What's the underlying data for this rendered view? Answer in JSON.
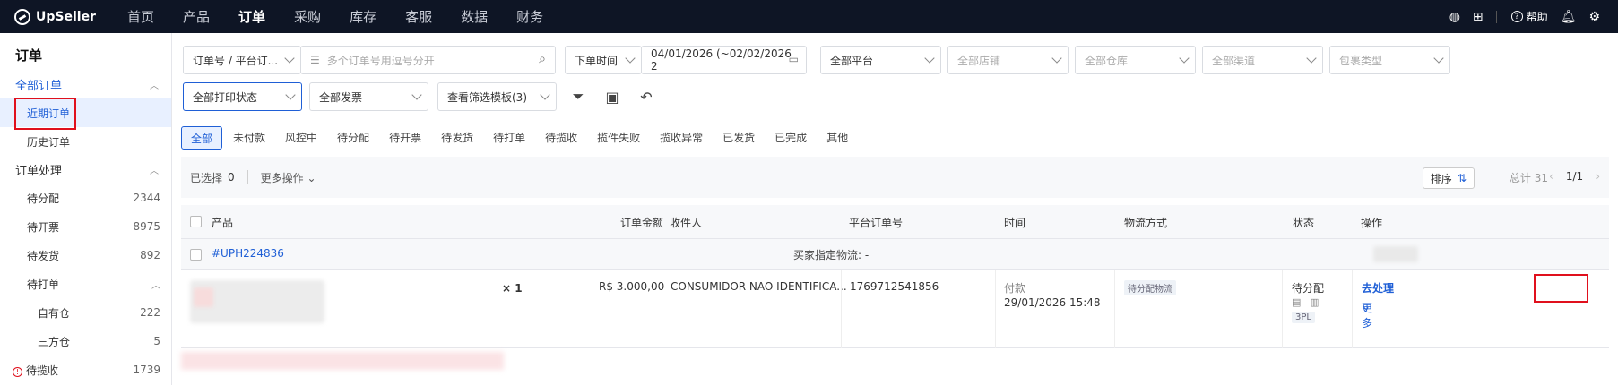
{
  "brand": "UpSeller",
  "nav": [
    "首页",
    "产品",
    "订单",
    "采购",
    "库存",
    "客服",
    "数据",
    "财务"
  ],
  "nav_active": "订单",
  "nav_right": {
    "help": "帮助"
  },
  "sidebar": {
    "title": "订单",
    "all_orders": "全部订单",
    "recent": "近期订单",
    "history": "历史订单",
    "processing": "订单处理",
    "to_allocate": {
      "label": "待分配",
      "count": "2344"
    },
    "to_invoice": {
      "label": "待开票",
      "count": "8975"
    },
    "to_ship": {
      "label": "待发货",
      "count": "892"
    },
    "to_print": "待打单",
    "own_wh": {
      "label": "自有仓",
      "count": "222"
    },
    "third_wh": {
      "label": "三方仓",
      "count": "5"
    },
    "to_pickup": {
      "label": "待揽收",
      "count": "1739"
    }
  },
  "filters": {
    "order_no_type": "订单号 / 平台订...",
    "order_no_placeholder": "多个订单号用逗号分开",
    "time_type": "下单时间",
    "date_range": "04/01/2026 (~02/02/2026 2",
    "platform": "全部平台",
    "store": "全部店铺",
    "warehouse": "全部仓库",
    "channel": "全部渠道",
    "package_type": "包裹类型",
    "print_status": "全部打印状态",
    "invoice": "全部发票",
    "template": "查看筛选模板(3)"
  },
  "tabs": [
    "全部",
    "未付款",
    "风控中",
    "待分配",
    "待开票",
    "待发货",
    "待打单",
    "待揽收",
    "揽件失败",
    "揽收异常",
    "已发货",
    "已完成",
    "其他"
  ],
  "toolbar": {
    "selected_label": "已选择",
    "selected_count": "0",
    "more_actions": "更多操作",
    "sort": "排序",
    "total": "总计 31",
    "page": "1/1"
  },
  "table": {
    "headers": {
      "product": "产品",
      "amount": "订单金额",
      "receiver": "收件人",
      "platform_no": "平台订单号",
      "time": "时间",
      "logistics": "物流方式",
      "status": "状态",
      "action": "操作"
    },
    "group": {
      "order_id": "#UPH224836",
      "buyer_logistics": "买家指定物流: -"
    },
    "row": {
      "qty": "× 1",
      "amount": "R$ 3.000,00",
      "receiver": "CONSUMIDOR NAO IDENTIFICA...",
      "platform_no": "1769712541856",
      "time_label": "付款",
      "time_value": "29/01/2026 15:48",
      "logistics_tag": "待分配物流",
      "status": "待分配",
      "status_tag": "3PL",
      "action_main": "去处理",
      "action_more": "更多"
    }
  }
}
